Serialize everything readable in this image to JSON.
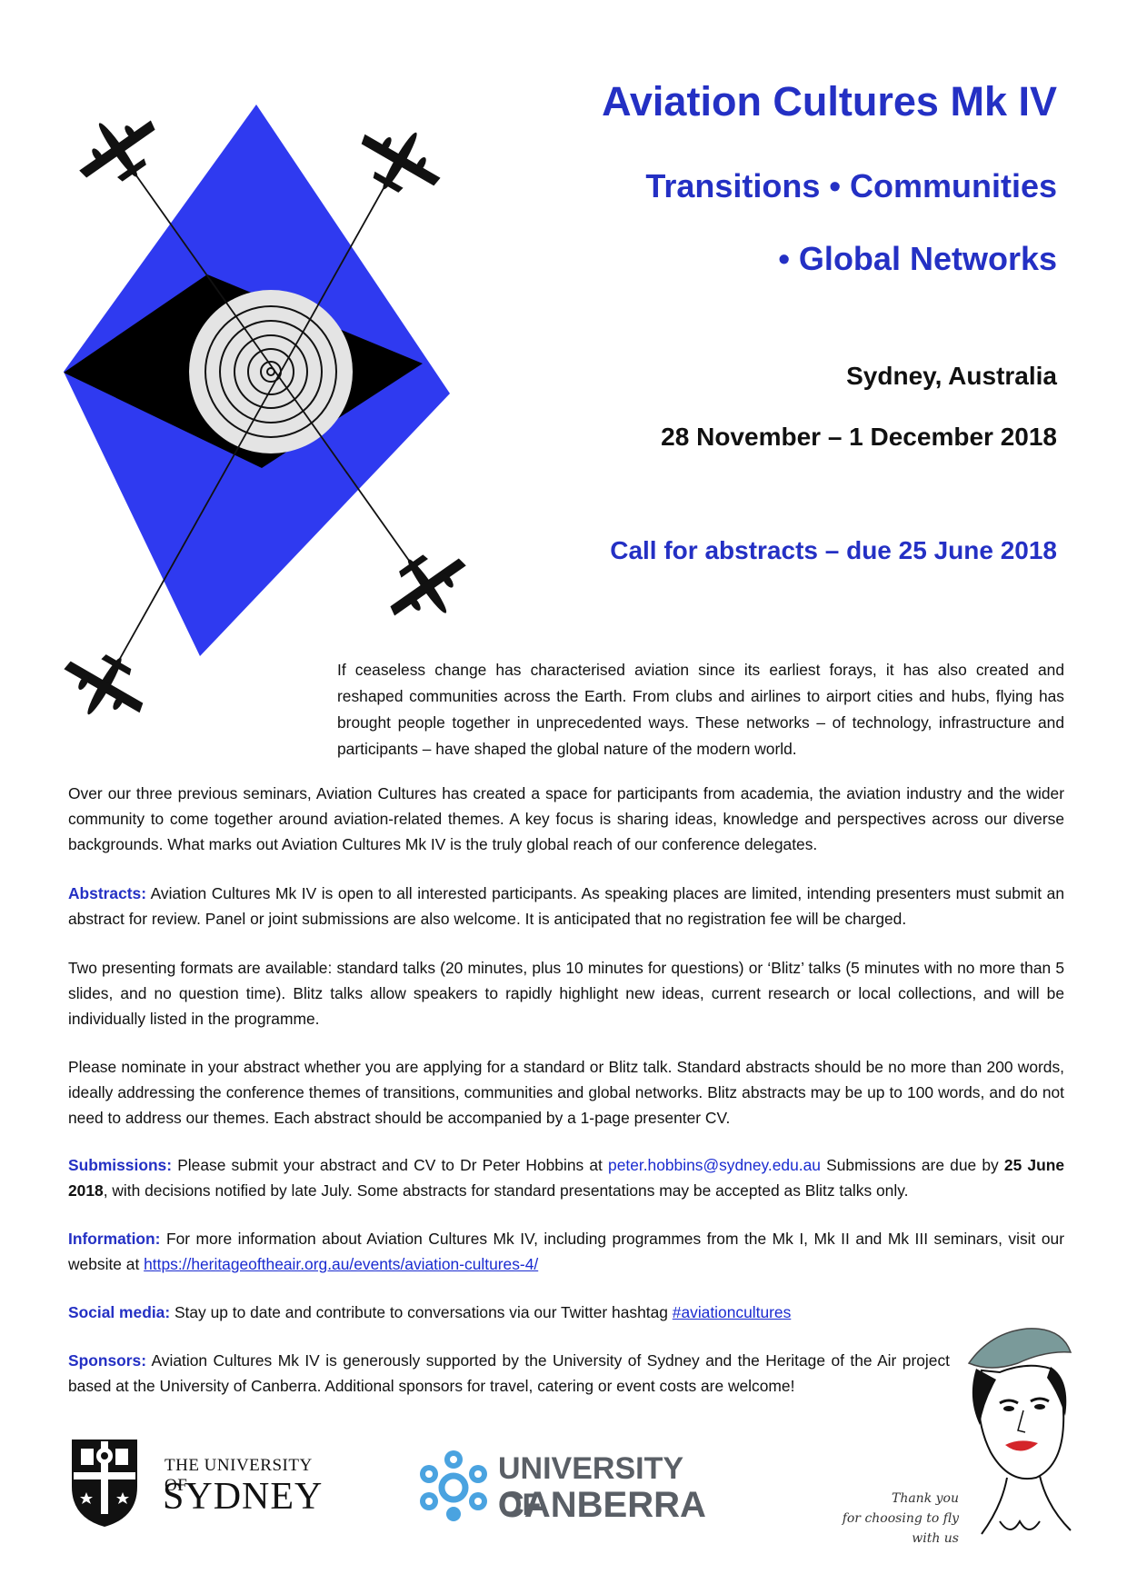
{
  "header": {
    "title": "Aviation Cultures Mk IV",
    "subtitle_line1": "Transitions • Communities",
    "subtitle_line2": "• Global Networks",
    "location": "Sydney, Australia",
    "dates": "28 November – 1 December 2018",
    "call": "Call for abstracts – due 25 June 2018"
  },
  "intro": "If ceaseless change has characterised aviation since its earliest forays, it has also created and reshaped communities across the Earth. From clubs and airlines to airport cities and hubs, flying has brought people together in unprecedented ways. These networks – of technology, infrastructure and participants – have shaped the global nature of the modern world.",
  "paragraphs": {
    "seminars": "Over our three previous seminars, Aviation Cultures has created a space for participants from academia, the aviation industry and the wider community to come together around aviation-related themes. A key focus is sharing ideas, knowledge and perspectives across our diverse backgrounds. What marks out Aviation Cultures Mk IV is the truly global reach of our conference delegates.",
    "abstracts_label": "Abstracts:",
    "abstracts_text": " Aviation Cultures Mk IV is open to all interested participants. As speaking places are limited, intending presenters must submit an abstract for review. Panel or joint submissions are also welcome. It is anticipated that no registration fee will be charged.",
    "formats": "Two presenting formats are available: standard talks (20 minutes, plus 10 minutes for questions) or ‘Blitz’ talks (5 minutes with no more than 5 slides, and no question time). Blitz talks allow speakers to rapidly highlight new ideas, current research or local collections, and will be individually listed in the programme.",
    "nominate": "Please nominate in your abstract whether you are applying for a standard or Blitz talk. Standard abstracts should be no more than 200 words, ideally addressing the conference themes of transitions, communities and global networks. Blitz abstracts may be up to 100 words, and do not need to address our themes. Each abstract should be accompanied by a 1-page presenter CV.",
    "submissions_label": "Submissions:",
    "submissions_text1": " Please submit your abstract and CV to Dr Peter Hobbins at ",
    "submissions_email": "peter.hobbins@sydney.edu.au",
    "submissions_text2": " Submissions are due by ",
    "submissions_date": "25 June 2018",
    "submissions_text3": ", with decisions notified by late July. Some abstracts for standard presentations may be accepted as Blitz talks only.",
    "information_label": "Information:",
    "information_text": " For more information about Aviation Cultures Mk IV, including programmes from the Mk I, Mk II and Mk III seminars, visit our website at ",
    "information_link": "https://heritageoftheair.org.au/events/aviation-cultures-4/",
    "social_label": "Social media:",
    "social_text": " Stay up to date and contribute to conversations via our Twitter hashtag ",
    "social_link": "#aviationcultures",
    "sponsors_label": "Sponsors:",
    "sponsors_text": " Aviation Cultures Mk IV is generously supported by the University of Sydney and the Heritage of the Air project based at the University of Canberra. Additional sponsors for travel, catering or event costs are welcome!"
  },
  "logos": {
    "sydney_line1": "THE UNIVERSITY OF",
    "sydney_line2": "SYDNEY",
    "canberra_line1": "UNIVERSITY OF",
    "canberra_line2": "CANBERRA"
  },
  "stewardess": {
    "line1": "Thank you",
    "line2": "for choosing to fly",
    "line3": "with us"
  },
  "colors": {
    "accent_blue": "#2430c4",
    "poster_blue": "#2f3af0",
    "link_blue": "#1a2bd0"
  }
}
